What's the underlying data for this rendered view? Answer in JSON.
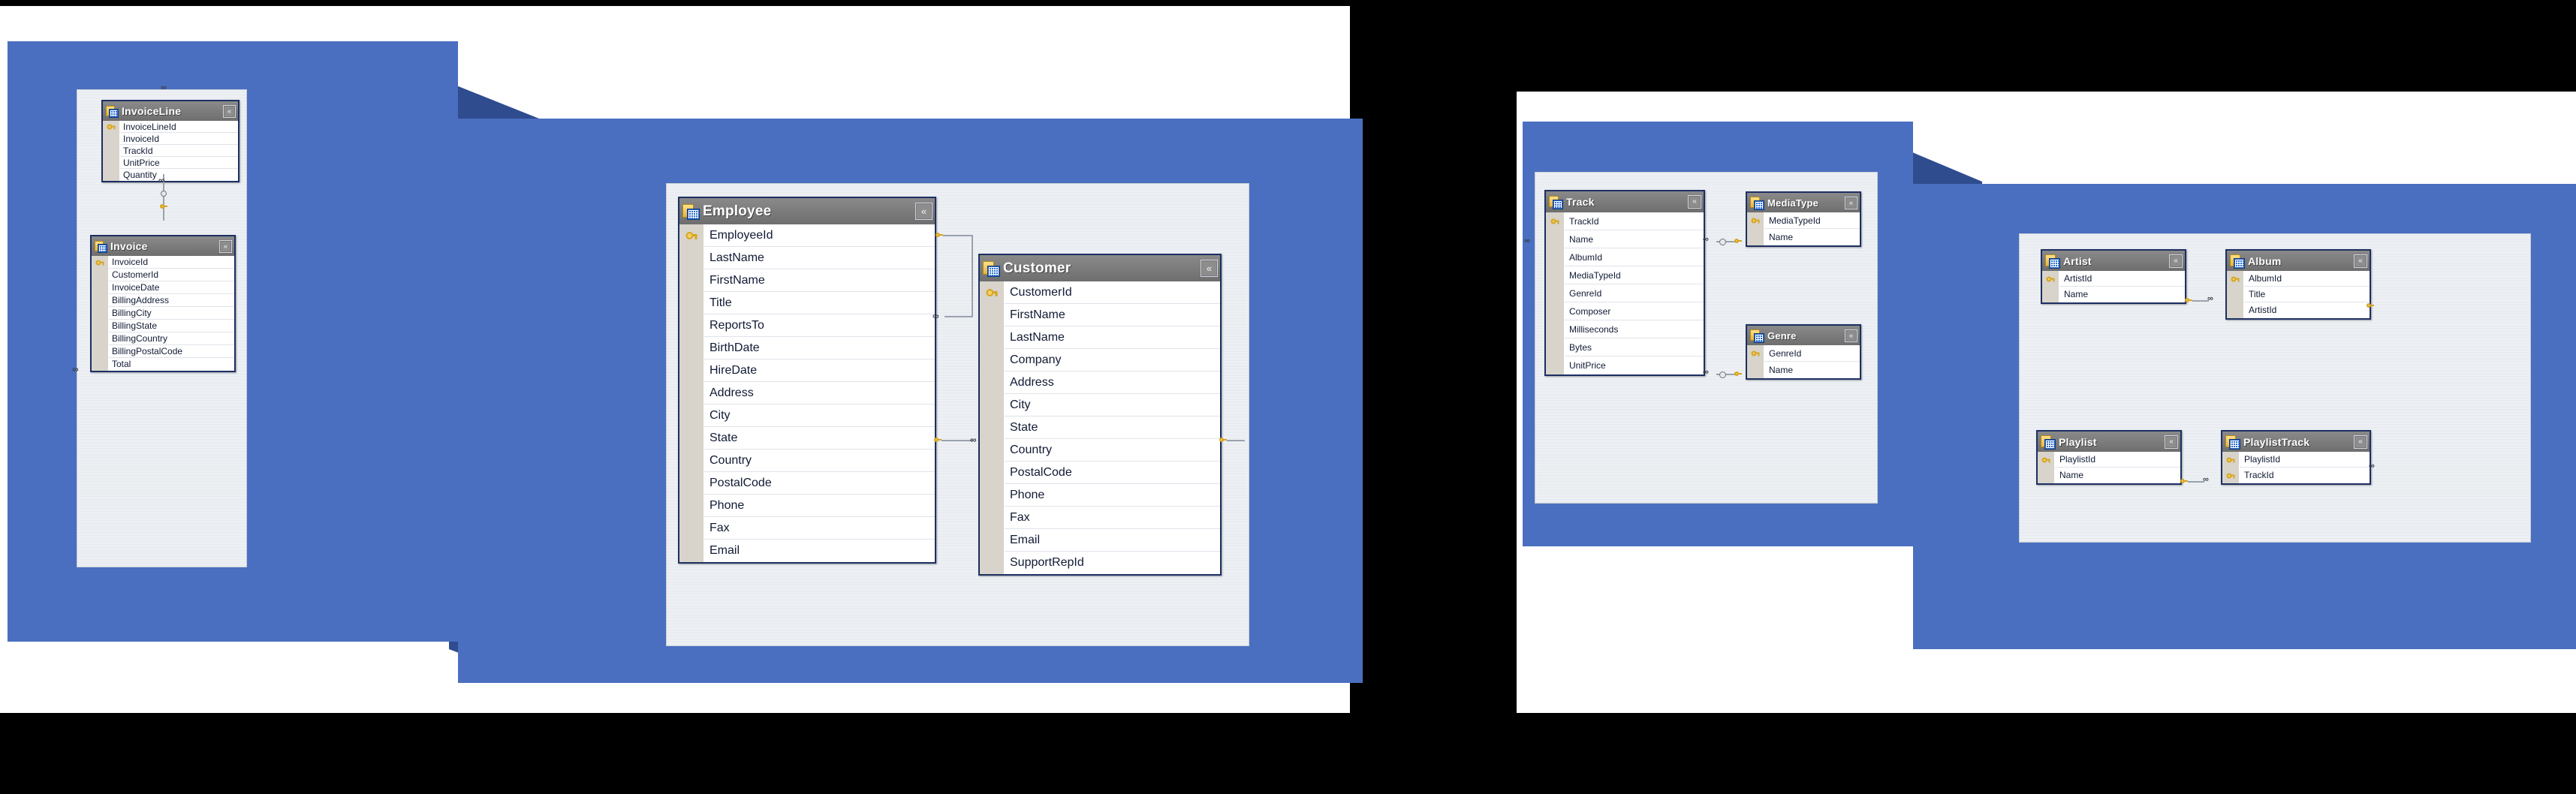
{
  "document": {
    "kind": "database-er-diagram",
    "description": "Chinook database entity relationship diagram shown in two overlapping screenshot panels"
  },
  "colors": {
    "panel_blue": "#4a6fc0",
    "panel_blue_shadow": "#2f4c8f",
    "entity_border": "#1d2f63",
    "entity_header": "#7b7b7b",
    "key_column": "#d8d4cb",
    "canvas": "#e9ecef",
    "sheet": "#ffffff",
    "backdrop": "#000000"
  },
  "icons": {
    "table_icon": "table-folder-icon",
    "collapse": "«",
    "collapse_name": "collapse-chevron-icon",
    "primary_key": "key-icon",
    "many": "∞"
  },
  "panels": [
    {
      "id": "left-panel",
      "name": "invoice-employee-customer-panel"
    },
    {
      "id": "right-panel",
      "name": "track-catalog-panel"
    }
  ],
  "entities": [
    {
      "name": "InvoiceLine",
      "panel": "left-panel",
      "fields": [
        "InvoiceLineId",
        "InvoiceId",
        "TrackId",
        "UnitPrice",
        "Quantity"
      ],
      "primary_keys": [
        "InvoiceLineId"
      ]
    },
    {
      "name": "Invoice",
      "panel": "left-panel",
      "fields": [
        "InvoiceId",
        "CustomerId",
        "InvoiceDate",
        "BillingAddress",
        "BillingCity",
        "BillingState",
        "BillingCountry",
        "BillingPostalCode",
        "Total"
      ],
      "primary_keys": [
        "InvoiceId"
      ]
    },
    {
      "name": "Employee",
      "panel": "left-panel",
      "fields": [
        "EmployeeId",
        "LastName",
        "FirstName",
        "Title",
        "ReportsTo",
        "BirthDate",
        "HireDate",
        "Address",
        "City",
        "State",
        "Country",
        "PostalCode",
        "Phone",
        "Fax",
        "Email"
      ],
      "primary_keys": [
        "EmployeeId"
      ]
    },
    {
      "name": "Customer",
      "panel": "left-panel",
      "fields": [
        "CustomerId",
        "FirstName",
        "LastName",
        "Company",
        "Address",
        "City",
        "State",
        "Country",
        "PostalCode",
        "Phone",
        "Fax",
        "Email",
        "SupportRepId"
      ],
      "primary_keys": [
        "CustomerId"
      ]
    },
    {
      "name": "Track",
      "panel": "right-panel",
      "fields": [
        "TrackId",
        "Name",
        "AlbumId",
        "MediaTypeId",
        "GenreId",
        "Composer",
        "Milliseconds",
        "Bytes",
        "UnitPrice"
      ],
      "primary_keys": [
        "TrackId"
      ]
    },
    {
      "name": "MediaType",
      "panel": "right-panel",
      "fields": [
        "MediaTypeId",
        "Name"
      ],
      "primary_keys": [
        "MediaTypeId"
      ]
    },
    {
      "name": "Genre",
      "panel": "right-panel",
      "fields": [
        "GenreId",
        "Name"
      ],
      "primary_keys": [
        "GenreId"
      ]
    },
    {
      "name": "Artist",
      "panel": "right-panel",
      "fields": [
        "ArtistId",
        "Name"
      ],
      "primary_keys": [
        "ArtistId"
      ]
    },
    {
      "name": "Album",
      "panel": "right-panel",
      "fields": [
        "AlbumId",
        "Title",
        "ArtistId"
      ],
      "primary_keys": [
        "AlbumId"
      ]
    },
    {
      "name": "Playlist",
      "panel": "right-panel",
      "fields": [
        "PlaylistId",
        "Name"
      ],
      "primary_keys": [
        "PlaylistId"
      ]
    },
    {
      "name": "PlaylistTrack",
      "panel": "right-panel",
      "fields": [
        "PlaylistId",
        "TrackId"
      ],
      "primary_keys": [
        "PlaylistId",
        "TrackId"
      ]
    }
  ],
  "relationships": [
    {
      "from": "Invoice",
      "to": "InvoiceLine",
      "cardinality": "one-to-many"
    },
    {
      "from": "Customer",
      "to": "Invoice",
      "cardinality": "one-to-many"
    },
    {
      "from": "Employee",
      "to": "Employee",
      "cardinality": "one-to-many"
    },
    {
      "from": "Employee",
      "to": "Customer",
      "cardinality": "one-to-many"
    },
    {
      "from": "MediaType",
      "to": "Track",
      "cardinality": "one-to-many"
    },
    {
      "from": "Genre",
      "to": "Track",
      "cardinality": "one-to-many"
    },
    {
      "from": "Artist",
      "to": "Album",
      "cardinality": "one-to-many"
    },
    {
      "from": "Playlist",
      "to": "PlaylistTrack",
      "cardinality": "one-to-many"
    },
    {
      "from": "Track",
      "to": "PlaylistTrack",
      "cardinality": "one-to-many"
    }
  ]
}
